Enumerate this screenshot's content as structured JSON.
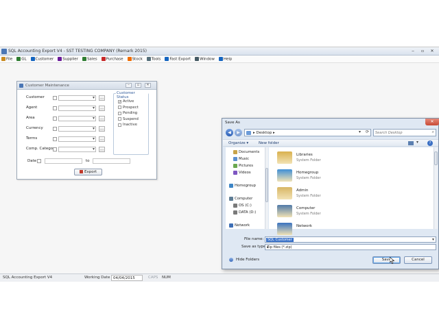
{
  "app": {
    "title": "SQL Accounting Export V4 - SST TESTING COMPANY (Remark 2015)",
    "menu": [
      "File",
      "GL",
      "Customer",
      "Supplier",
      "Sales",
      "Purchase",
      "Stock",
      "Tools",
      "Fast Export",
      "Window",
      "Help"
    ],
    "menu_icon_colors": [
      "#c98a1f",
      "#2e7d32",
      "#1565c0",
      "#6a1b9a",
      "#2e7d32",
      "#c62828",
      "#ef6c00",
      "#546e7a",
      "#1565c0",
      "#455a64",
      "#1565c0"
    ]
  },
  "customer_maintenance": {
    "title": "Customer Maintenance",
    "fields": [
      "Customer",
      "Agent",
      "Area",
      "Currency",
      "Terms",
      "Comp. Category"
    ],
    "status_group": {
      "title": "Customer Status",
      "items": [
        {
          "label": "Active",
          "checked": true
        },
        {
          "label": "Prospect",
          "checked": false
        },
        {
          "label": "Pending",
          "checked": false
        },
        {
          "label": "Suspend",
          "checked": false
        },
        {
          "label": "Inactive",
          "checked": false
        }
      ]
    },
    "date_label": "Date",
    "to_label": "to",
    "export_label": "Export"
  },
  "statusbar": {
    "app": "SQL Accounting Export V4",
    "working_date_label": "Working Date",
    "working_date": "04/04/2015",
    "caps": "CAPS",
    "num": "NUM"
  },
  "save_as": {
    "title": "Save As",
    "address": "Desktop",
    "search_placeholder": "Search Desktop",
    "organize": "Organize ▾",
    "new_folder": "New folder",
    "nav_items": [
      "Documents",
      "Music",
      "Pictures",
      "Videos",
      "Homegroup",
      "Computer",
      "OS (C:)",
      "DATA (D:)",
      "Network"
    ],
    "files": [
      {
        "name": "Libraries",
        "type": "System Folder"
      },
      {
        "name": "Homegroup",
        "type": "System Folder"
      },
      {
        "name": "Admin",
        "type": "System Folder"
      },
      {
        "name": "Computer",
        "type": "System Folder"
      },
      {
        "name": "Network",
        "type": ""
      }
    ],
    "file_name_label": "File name:",
    "file_name_value": "SQL Customer",
    "save_as_type_label": "Save as type:",
    "save_as_type_value": "Zip files (*.zip)",
    "hide_folders": "Hide Folders",
    "save_label": "Save",
    "cancel_label": "Cancel"
  }
}
